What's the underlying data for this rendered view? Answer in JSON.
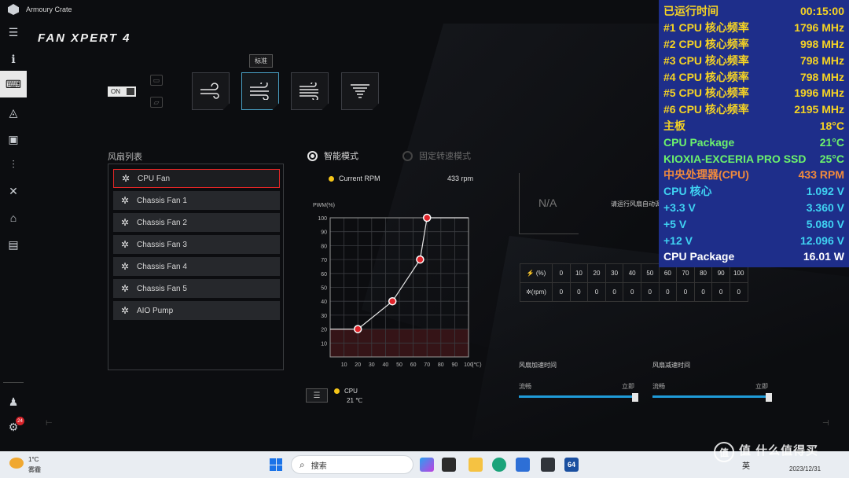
{
  "app": {
    "title": "Armoury Crate"
  },
  "page": {
    "title": "FAN XPERT 4"
  },
  "toggle": {
    "label": "ON"
  },
  "modes": {
    "tooltip": "标准",
    "active_index": 1
  },
  "fan_list": {
    "title": "风扇列表",
    "items": [
      "CPU Fan",
      "Chassis Fan 1",
      "Chassis Fan 2",
      "Chassis Fan 3",
      "Chassis Fan 4",
      "Chassis Fan 5",
      "AIO Pump"
    ],
    "selected": "CPU Fan"
  },
  "control_modes": {
    "smart": "智能模式",
    "fixed": "固定转速模式"
  },
  "current_rpm": {
    "label": "Current RPM",
    "value": "433 rpm"
  },
  "chart_data": {
    "type": "line",
    "ylabel": "PWM(%)",
    "xunit": "(℃)",
    "x": [
      20,
      45,
      65,
      70
    ],
    "y": [
      20,
      40,
      70,
      100
    ],
    "xlim": [
      0,
      100
    ],
    "ylim": [
      0,
      100
    ],
    "xticks": [
      "10",
      "20",
      "30",
      "40",
      "50",
      "60",
      "70",
      "80",
      "90",
      "100"
    ],
    "yticks": [
      "100",
      "90",
      "80",
      "70",
      "60",
      "50",
      "40",
      "30",
      "20",
      "10"
    ],
    "grid": true,
    "baseline_fill_y": 20
  },
  "sensor": {
    "label": "CPU",
    "value": "21 ℃"
  },
  "na": {
    "text": "N/A",
    "hint": "请运行风扇自动调整以获得自定义设置"
  },
  "rpm_table": {
    "percent_header": "(%)",
    "rpm_header": "(rpm)",
    "percents": [
      "0",
      "10",
      "20",
      "30",
      "40",
      "50",
      "60",
      "70",
      "80",
      "90",
      "100"
    ],
    "rpms": [
      "0",
      "0",
      "0",
      "0",
      "0",
      "0",
      "0",
      "0",
      "0",
      "0",
      "0"
    ]
  },
  "sliders": [
    {
      "title": "风扇加速时间",
      "left_label": "流畅",
      "right_label": "立即",
      "value_pct": 100
    },
    {
      "title": "风扇减速时间",
      "left_label": "流畅",
      "right_label": "立即",
      "value_pct": 100
    }
  ],
  "osd": {
    "rows": [
      {
        "label": "已运行时间",
        "value": "00:15:00",
        "color": "#f5d324"
      },
      {
        "label": "#1 CPU 核心频率",
        "value": "1796 MHz",
        "color": "#f5d324"
      },
      {
        "label": "#2 CPU 核心频率",
        "value": "998 MHz",
        "color": "#f5d324"
      },
      {
        "label": "#3 CPU 核心频率",
        "value": "798 MHz",
        "color": "#f5d324"
      },
      {
        "label": "#4 CPU 核心频率",
        "value": "798 MHz",
        "color": "#f5d324"
      },
      {
        "label": "#5 CPU 核心频率",
        "value": "1996 MHz",
        "color": "#f5d324"
      },
      {
        "label": "#6 CPU 核心频率",
        "value": "2195 MHz",
        "color": "#f5d324"
      },
      {
        "label": "主板",
        "value": "18°C",
        "color": "#f5d324"
      },
      {
        "label": "CPU Package",
        "value": "21°C",
        "color": "#6cf26c"
      },
      {
        "label": "KIOXIA-EXCERIA PRO SSD",
        "value": "25°C",
        "color": "#6cf26c"
      },
      {
        "label": "中央处理器(CPU)",
        "value": "433 RPM",
        "color": "#f08a3c"
      },
      {
        "label": "CPU 核心",
        "value": "1.092 V",
        "color": "#3fd2f2"
      },
      {
        "label": "+3.3 V",
        "value": "3.360 V",
        "color": "#3fd2f2"
      },
      {
        "label": "+5 V",
        "value": "5.080 V",
        "color": "#3fd2f2"
      },
      {
        "label": "+12 V",
        "value": "12.096 V",
        "color": "#3fd2f2"
      },
      {
        "label": "CPU Package",
        "value": "16.01 W",
        "color": "#ffffff"
      }
    ]
  },
  "taskbar": {
    "weather_temp": "1°C",
    "weather_desc": "雾霾",
    "search_placeholder": "搜索",
    "ime": "英",
    "date": "2023/12/31",
    "notification_count": "24"
  },
  "watermark": "值 什么值得买"
}
